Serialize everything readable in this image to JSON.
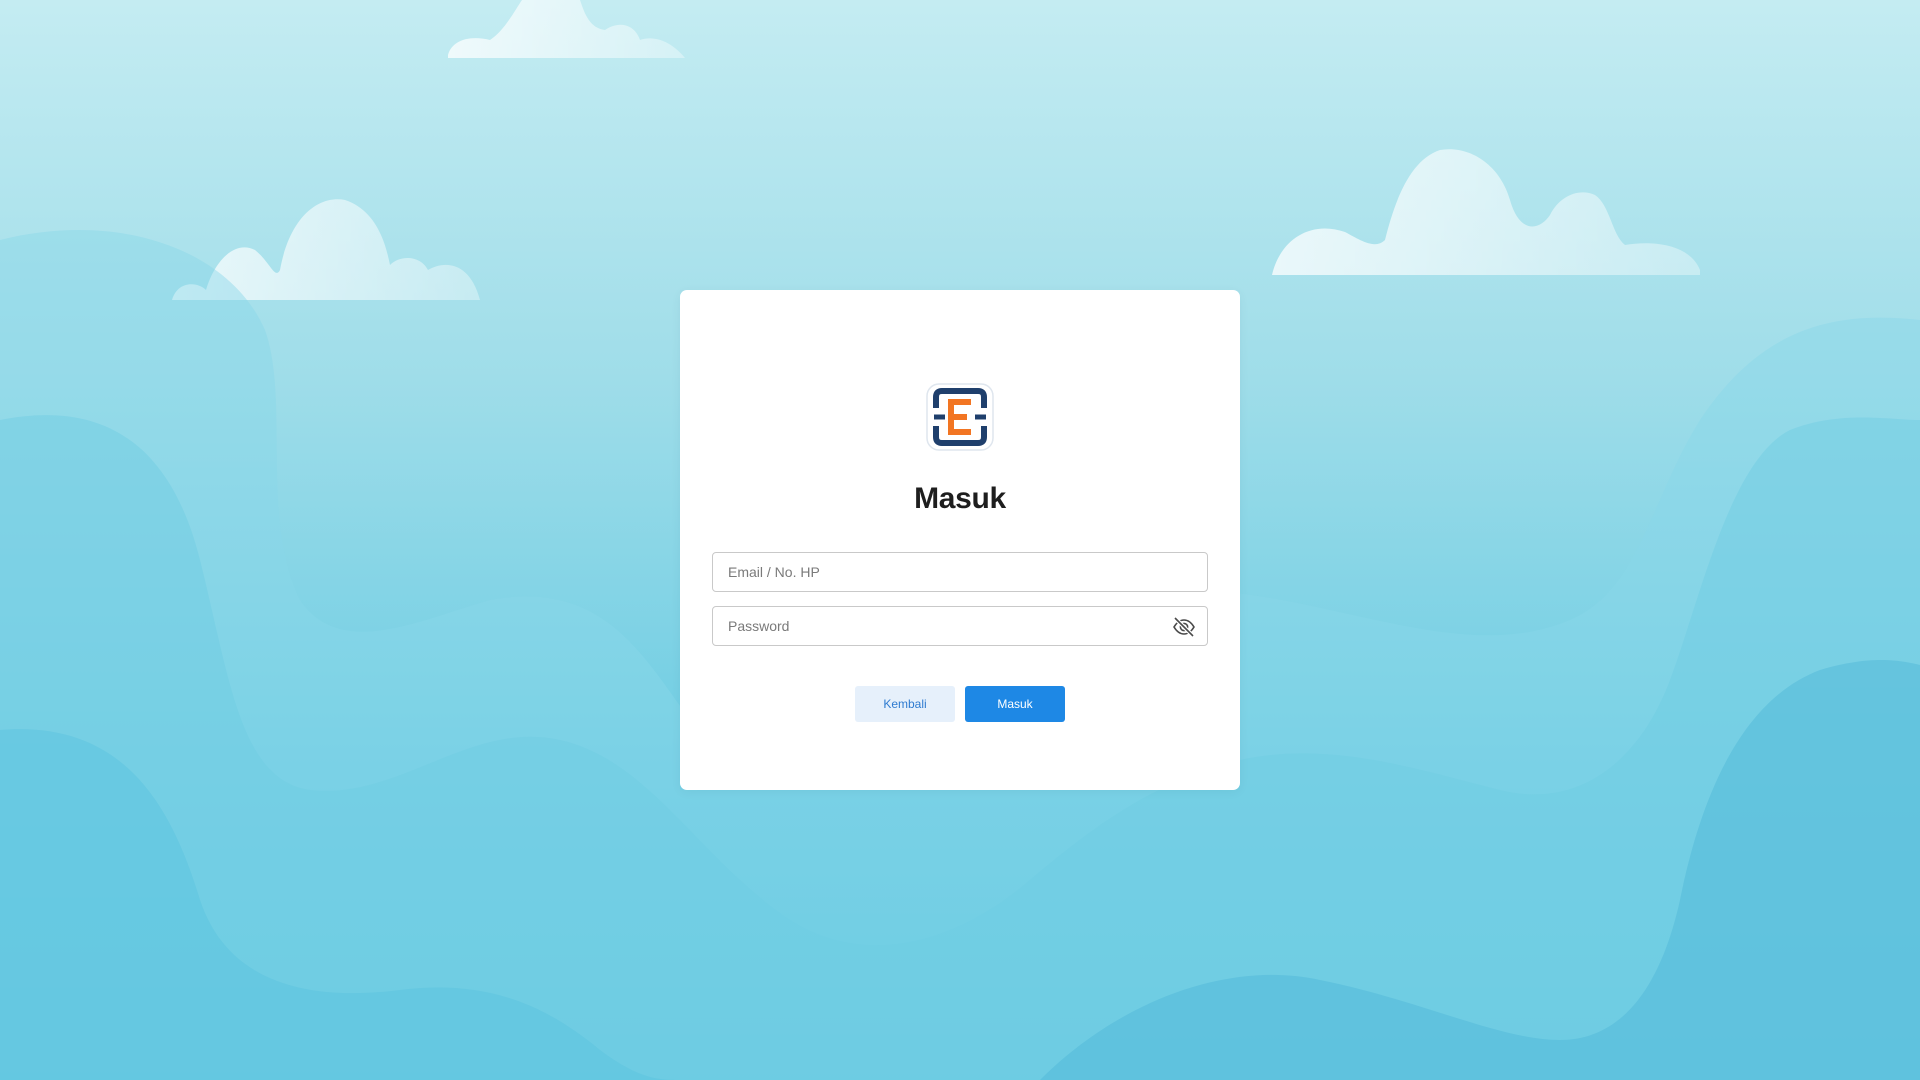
{
  "login": {
    "title": "Masuk",
    "email_placeholder": "Email / No. HP",
    "email_value": "",
    "password_placeholder": "Password",
    "password_value": "",
    "back_label": "Kembali",
    "submit_label": "Masuk"
  },
  "icons": {
    "logo": "company-logo",
    "password_toggle": "eye-slash-icon"
  },
  "colors": {
    "primary": "#1e88e5",
    "secondary_bg": "#e6f0fb",
    "secondary_text": "#2f7bd0",
    "logo_navy": "#1f3f6c",
    "logo_orange": "#f27522",
    "background_top": "#c4ecf2",
    "background_bottom": "#55c4e0"
  }
}
